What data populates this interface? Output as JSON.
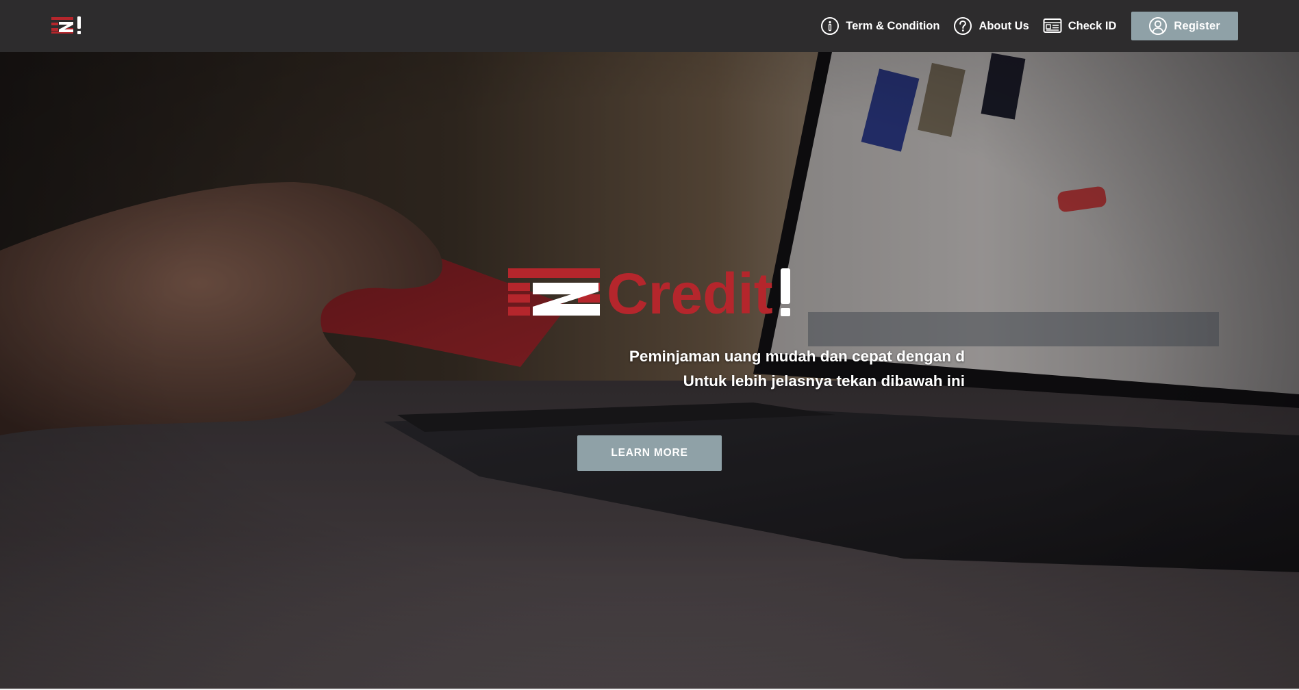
{
  "brand": {
    "logo_text": "Credit",
    "logo_exclaim": "!",
    "logo_mark_letter": "Z",
    "red": "#b5262c",
    "white": "#ffffff"
  },
  "nav": {
    "items": [
      {
        "label": "Term & Condition",
        "icon": "info-circle-icon"
      },
      {
        "label": "About Us",
        "icon": "question-circle-icon"
      },
      {
        "label": "Check ID",
        "icon": "id-card-icon"
      }
    ],
    "register_label": "Register",
    "register_icon": "user-circle-icon"
  },
  "hero": {
    "tagline_1": "Peminjaman uang mudah dan cepat dengan d",
    "tagline_2": "Untuk lebih jelasnya tekan dibawah ini",
    "cta_label": "LEARN MORE",
    "image_description": "hand-holding-credit-card-laptop"
  },
  "colors": {
    "navbar_bg": "#2d2c2d",
    "button_bg": "#8fa1a7"
  }
}
